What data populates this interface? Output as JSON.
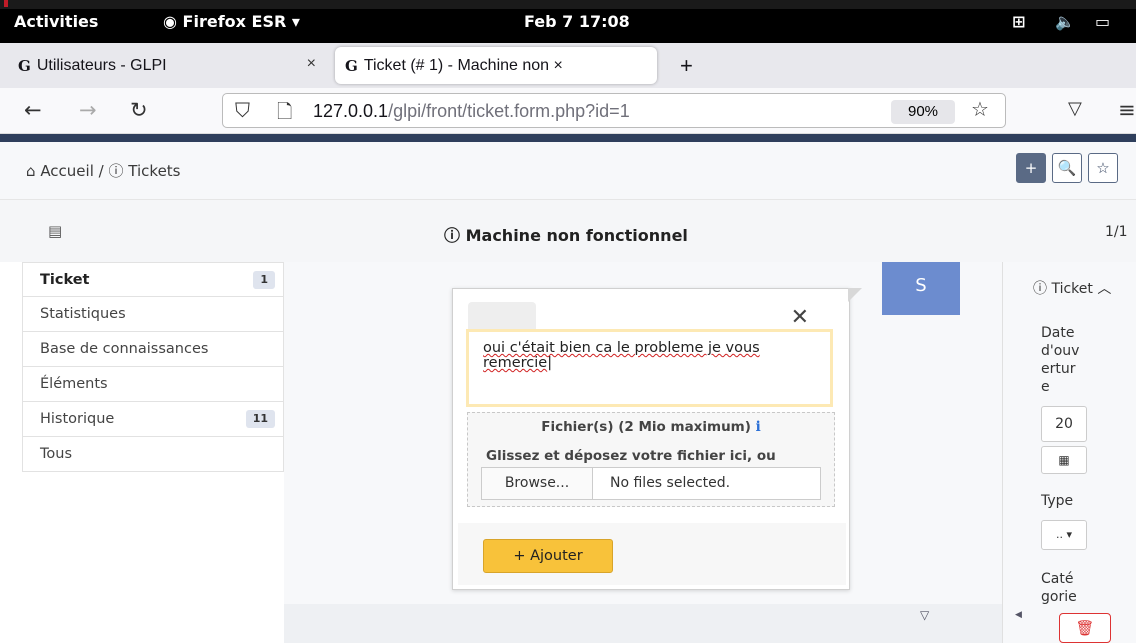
{
  "system_bar": {
    "activities": "Activities",
    "app": "Firefox ESR ▾",
    "datetime": "Feb 7  17:08",
    "network_icon": "network-icon",
    "volume_icon": "volume-icon",
    "battery_icon": "battery-icon"
  },
  "browser": {
    "tabs": [
      {
        "label": "Utilisateurs - GLPI",
        "close": "×"
      },
      {
        "label": "Ticket (# 1) - Machine non ×",
        "close": ""
      }
    ],
    "new_tab": "+",
    "url_host": "127.0.0.1",
    "url_path": "/glpi/front/ticket.form.php?id=1",
    "zoom": "90%"
  },
  "glpi": {
    "breadcrumb": {
      "home": "Accueil",
      "sep": "/",
      "current": "Tickets"
    },
    "header_buttons": [
      "+",
      "🔍",
      "☆"
    ],
    "ticket_title": "Machine non fonctionnel",
    "pager": "1/1",
    "left_tabs": [
      {
        "label": "Ticket",
        "count": "1"
      },
      {
        "label": "Statistiques",
        "count": ""
      },
      {
        "label": "Base de connaissances",
        "count": ""
      },
      {
        "label": "Éléments",
        "count": ""
      },
      {
        "label": "Historique",
        "count": "11"
      },
      {
        "label": "Tous",
        "count": ""
      }
    ],
    "avatar_letter": "S",
    "followup": {
      "text": "oui c'était bien ca le probleme je vous remercie",
      "files_title": "Fichier(s) (2 Mio maximum)",
      "files_info": "i",
      "drop_hint": "Glissez et déposez votre fichier ici, ou",
      "browse_label": "Browse...",
      "no_file": "No files selected.",
      "add_button": "+ Ajouter"
    },
    "right_panel": {
      "header": "Ticket",
      "date_label": "Date d'ouverture",
      "date_value": "20",
      "type_label": "Type",
      "type_value": ".. ▾",
      "category_label": "Catégorie"
    }
  }
}
